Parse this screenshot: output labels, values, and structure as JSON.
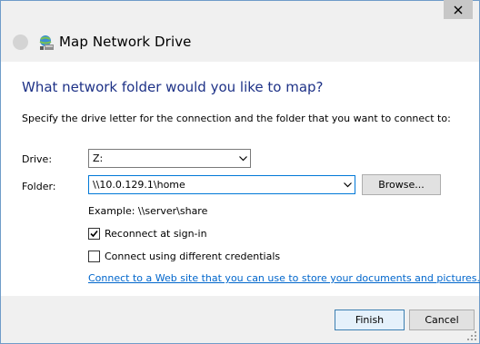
{
  "window": {
    "title": "Map Network Drive"
  },
  "heading": "What network folder would you like to map?",
  "instruction": "Specify the drive letter for the connection and the folder that you want to connect to:",
  "drive": {
    "label": "Drive:",
    "value": "Z:"
  },
  "folder": {
    "label": "Folder:",
    "value": "\\\\10.0.129.1\\home"
  },
  "browse_label": "Browse...",
  "example": "Example: \\\\server\\share",
  "reconnect": {
    "label": "Reconnect at sign-in",
    "checked": true
  },
  "different_credentials": {
    "label": "Connect using different credentials",
    "checked": false
  },
  "link": "Connect to a Web site that you can use to store your documents and pictures.",
  "footer": {
    "finish_label": "Finish",
    "cancel_label": "Cancel"
  },
  "colors": {
    "heading": "#1e3287",
    "link": "#0066cc",
    "window_border": "#6f9cc9",
    "close_button": "#c7c7c7"
  },
  "icons": [
    "close-icon",
    "back-icon",
    "network-drive-icon",
    "chevron-down-icon",
    "checkmark-icon",
    "resize-grip-icon"
  ]
}
